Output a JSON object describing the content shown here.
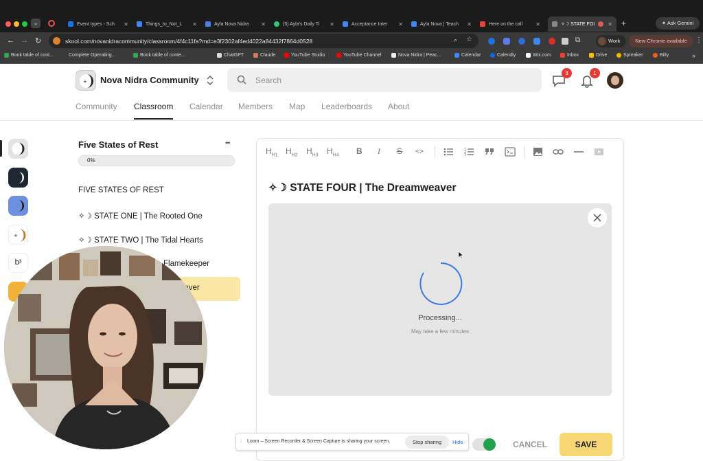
{
  "browser": {
    "tabs": [
      {
        "label": "Event types - Sch"
      },
      {
        "label": "Things_to_Not_L"
      },
      {
        "label": "Ayla Nova Nidra"
      },
      {
        "label": "(5) Ayla's Daily Ti"
      },
      {
        "label": "Acceptance Inter"
      },
      {
        "label": "Ayla Nova | Teach"
      },
      {
        "label": "Here on the call"
      },
      {
        "label": "✧☽ STATE FOI"
      }
    ],
    "ask_gemini": "Ask Gemini",
    "url": "skool.com/novanidracommunity/classroom/4f4c11fa?md=e3f2302af4ed4022a84432f7864d0528",
    "profile": "Work",
    "update": "New Chrome available",
    "bookmarks": [
      "Book table of cont...",
      "Complete Operating...",
      "Book table of conte...",
      "ChatGPT",
      "Claude",
      "YouTube Studio",
      "YouTube Channel",
      "Nova Nidra | Peac...",
      "Calendar",
      "Calendly",
      "Wix.com",
      "Inbox",
      "Drive",
      "Spreaker",
      "Bitly"
    ]
  },
  "header": {
    "community_name": "Nova Nidra Community",
    "search_placeholder": "Search",
    "chat_badge": "3",
    "notif_badge": "1",
    "nav": [
      "Community",
      "Classroom",
      "Calendar",
      "Members",
      "Map",
      "Leaderboards",
      "About"
    ]
  },
  "course": {
    "title": "Five States of Rest",
    "more": "•••",
    "progress": "0%",
    "progress_value": 0,
    "lessons": [
      "FIVE STATES OF REST",
      "✧☽ STATE ONE | The Rooted One",
      "✧☽ STATE TWO | The Tidal Hearts",
      "Flamekeeper",
      "eaver"
    ]
  },
  "editor": {
    "toolbar": [
      "H1",
      "H2",
      "H3",
      "H4",
      "B",
      "I",
      "S",
      "<>"
    ],
    "heading": "✧☽ STATE FOUR | The Dreamweaver",
    "processing": "Processing...",
    "processing_sub": "May take a few minutes",
    "cancel": "CANCEL",
    "save": "SAVE"
  },
  "loom": {
    "message": "Loom – Screen Recorder & Screen Capture is sharing your screen.",
    "stop": "Stop sharing",
    "hide": "Hide"
  }
}
